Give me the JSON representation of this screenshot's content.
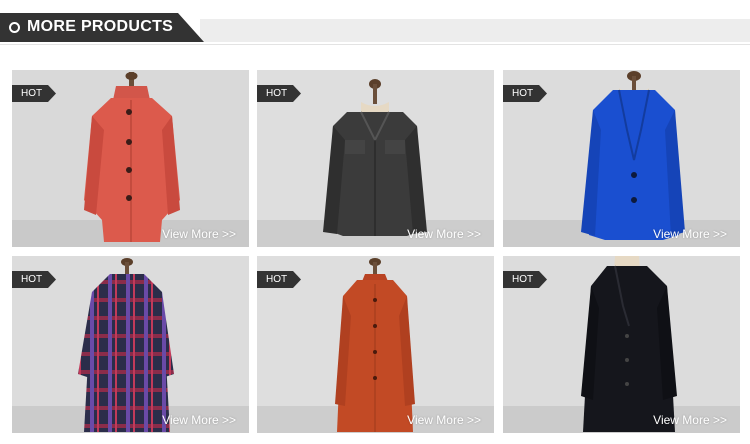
{
  "section": {
    "title": "MORE PRODUCTS"
  },
  "products": [
    {
      "badge": "HOT",
      "link_label": "View More >>",
      "coat_color": "#dc5a4c",
      "icon": "stand-collar-coat"
    },
    {
      "badge": "HOT",
      "link_label": "View More >>",
      "coat_color": "#3b3b3b",
      "icon": "tweed-jacket"
    },
    {
      "badge": "HOT",
      "link_label": "View More >>",
      "coat_color": "#1a4fd0",
      "icon": "blazer-jacket"
    },
    {
      "badge": "HOT",
      "link_label": "View More >>",
      "coat_color": "#3a3555",
      "icon": "plaid-coat"
    },
    {
      "badge": "HOT",
      "link_label": "View More >>",
      "coat_color": "#c24a25",
      "icon": "long-shirt-coat"
    },
    {
      "badge": "HOT",
      "link_label": "View More >>",
      "coat_color": "#15161c",
      "icon": "long-overcoat"
    }
  ]
}
